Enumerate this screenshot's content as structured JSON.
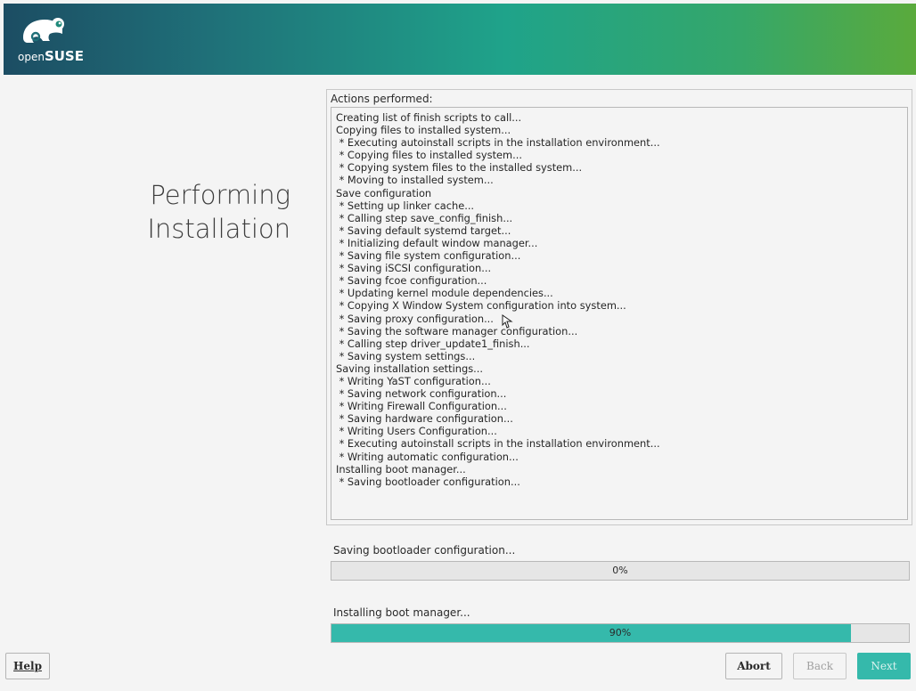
{
  "header": {
    "logo_prefix": "open",
    "logo_suffix": "SUSE"
  },
  "page_title": {
    "line1": "Performing",
    "line2": "Installation"
  },
  "actions": {
    "label": "Actions performed:",
    "log": [
      "Creating list of finish scripts to call...",
      "Copying files to installed system...",
      " * Executing autoinstall scripts in the installation environment...",
      " * Copying files to installed system...",
      " * Copying system files to the installed system...",
      " * Moving to installed system...",
      "Save configuration",
      " * Setting up linker cache...",
      " * Calling step save_config_finish...",
      " * Saving default systemd target...",
      " * Initializing default window manager...",
      " * Saving file system configuration...",
      " * Saving iSCSI configuration...",
      " * Saving fcoe configuration...",
      " * Updating kernel module dependencies...",
      " * Copying X Window System configuration into system...",
      " * Saving proxy configuration...",
      " * Saving the software manager configuration...",
      " * Calling step driver_update1_finish...",
      " * Saving system settings...",
      "Saving installation settings...",
      " * Writing YaST configuration...",
      " * Saving network configuration...",
      " * Writing Firewall Configuration...",
      " * Saving hardware configuration...",
      " * Writing Users Configuration...",
      " * Executing autoinstall scripts in the installation environment...",
      " * Writing automatic configuration...",
      "Installing boot manager...",
      " * Saving bootloader configuration..."
    ]
  },
  "progress": {
    "step": {
      "label": "Saving bootloader configuration...",
      "percent_text": "0%",
      "value": 0
    },
    "stage": {
      "label": "Installing boot manager...",
      "percent_text": "90%",
      "value": 90
    }
  },
  "buttons": {
    "help": "Help",
    "abort": "Abort",
    "back": "Back",
    "next": "Next"
  },
  "colors": {
    "accent": "#35b9ab",
    "banner_start": "#1c4d63",
    "banner_end": "#5aaa3c"
  },
  "icons": {
    "logo": "opensuse-chameleon-logo",
    "cursor": "hand-pointer-cursor"
  }
}
